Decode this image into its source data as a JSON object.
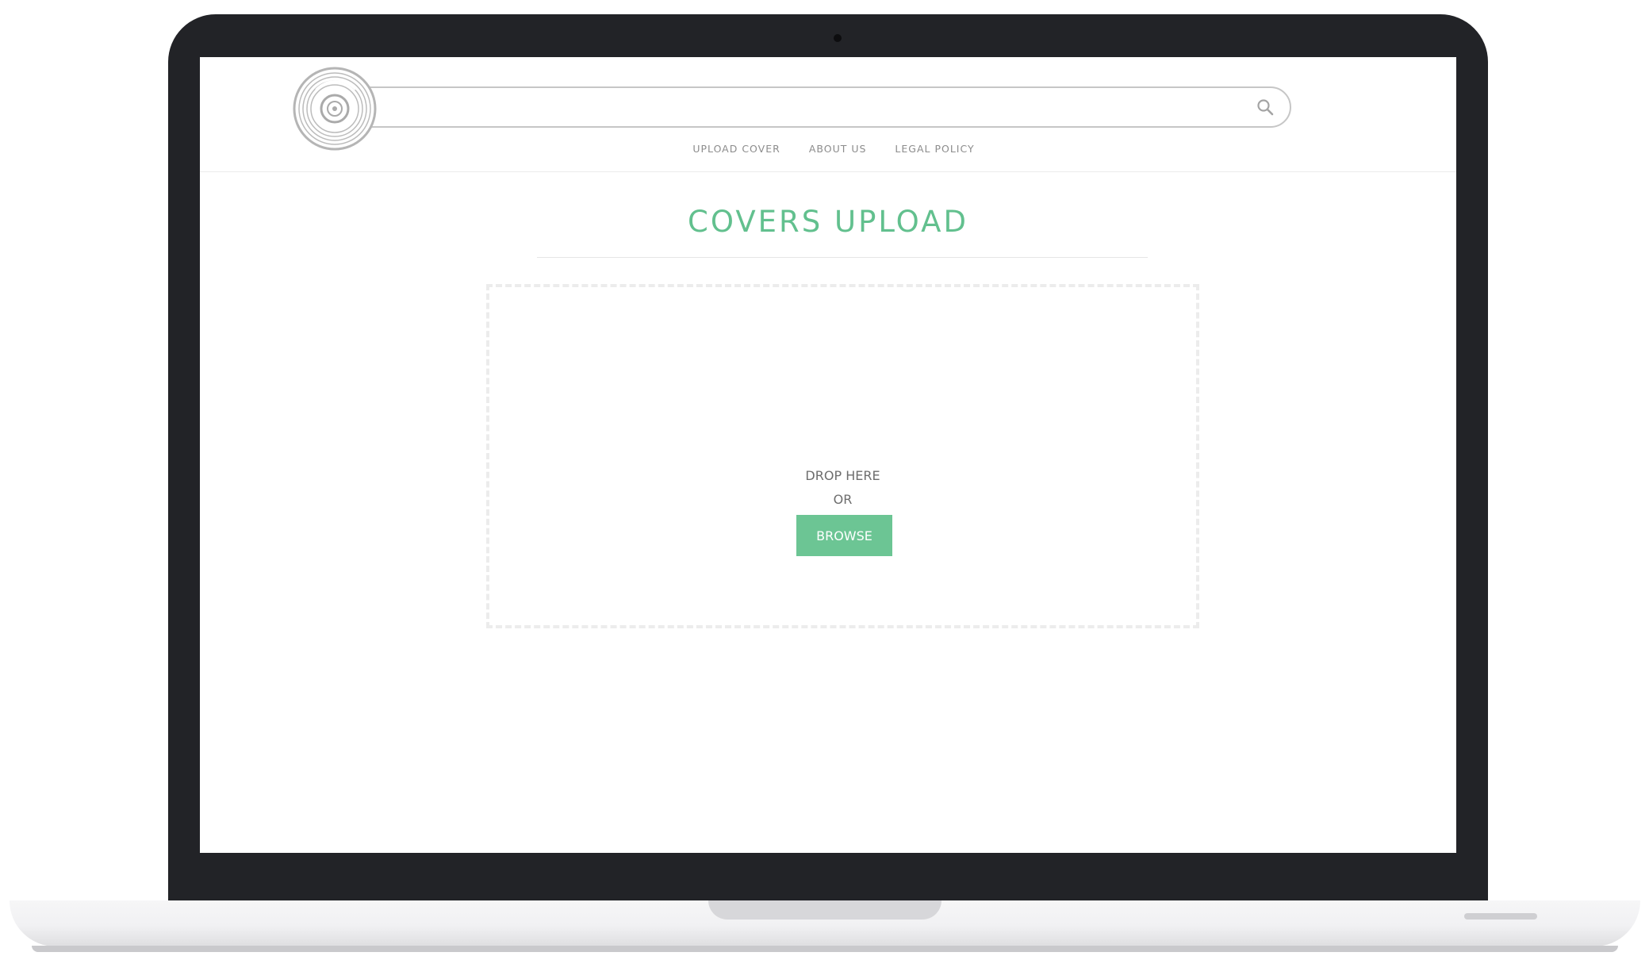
{
  "colors": {
    "accent": "#62c08e",
    "button": "#6cc594",
    "frame": "#222327"
  },
  "header": {
    "logo_icon": "vinyl-record-icon",
    "search": {
      "placeholder": "",
      "value": "",
      "icon": "search-icon"
    },
    "nav": {
      "items": [
        {
          "label": "UPLOAD COVER"
        },
        {
          "label": "ABOUT US"
        },
        {
          "label": "LEGAL POLICY"
        }
      ]
    }
  },
  "main": {
    "title": "COVERS UPLOAD",
    "dropzone": {
      "drop_label": "DROP HERE",
      "or_label": "OR",
      "browse_label": "BROWSE"
    }
  }
}
